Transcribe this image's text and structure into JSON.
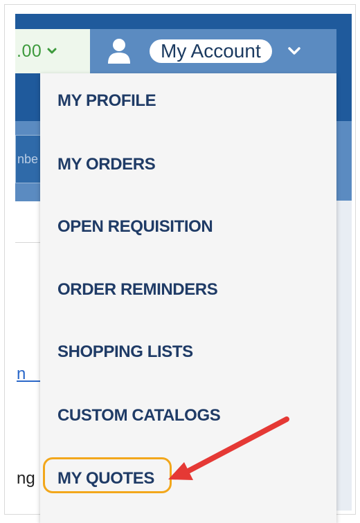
{
  "header": {
    "cart_amount": ".00",
    "account_label": "My Account"
  },
  "background": {
    "left_input_text": "nbe",
    "left_link_text": "n c",
    "left_text": "ng"
  },
  "account_menu": {
    "items": [
      {
        "label": "MY PROFILE"
      },
      {
        "label": "MY ORDERS"
      },
      {
        "label": "OPEN REQUISITION"
      },
      {
        "label": "ORDER REMINDERS"
      },
      {
        "label": "SHOPPING LISTS"
      },
      {
        "label": "CUSTOM CATALOGS"
      },
      {
        "label": "MY QUOTES"
      }
    ],
    "highlighted_item": "MY QUOTES"
  },
  "annotation": {
    "highlight_color": "#f2a71b",
    "arrow_color": "#e53935"
  },
  "colors": {
    "header_bg": "#1f5a9c",
    "account_bg": "#5b8bc1",
    "menu_text": "#1f3b66",
    "cart_green": "#3d9a3d"
  },
  "icons": [
    "chevron-down-icon",
    "user-icon"
  ]
}
